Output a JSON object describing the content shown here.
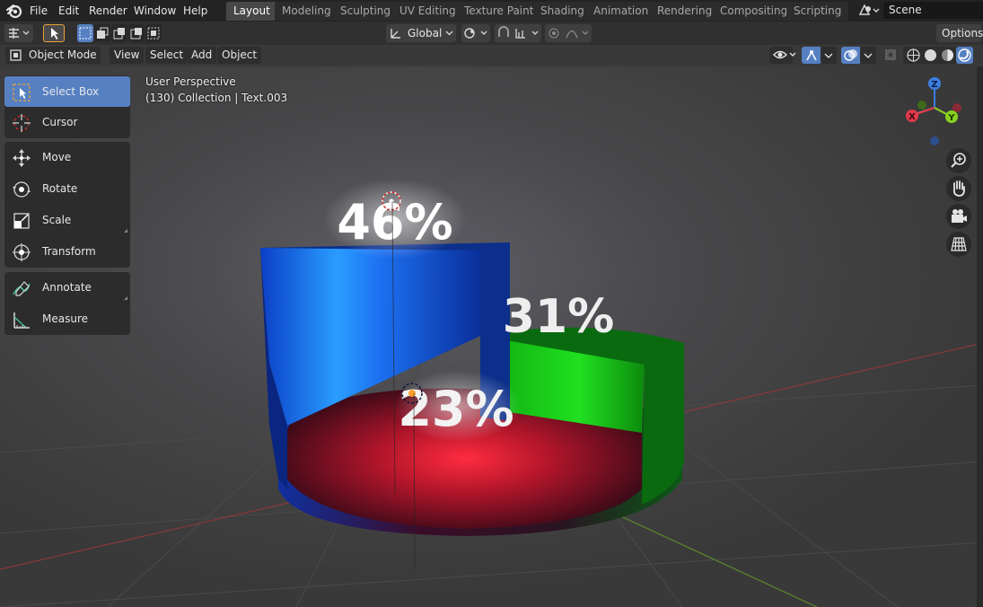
{
  "menu": {
    "file": "File",
    "edit": "Edit",
    "render": "Render",
    "window": "Window",
    "help": "Help"
  },
  "workspaces": [
    "Layout",
    "Modeling",
    "Sculpting",
    "UV Editing",
    "Texture Paint",
    "Shading",
    "Animation",
    "Rendering",
    "Compositing",
    "Scripting"
  ],
  "scene": {
    "name": "Scene"
  },
  "header": {
    "transform_orientation": "Global",
    "options": "Options"
  },
  "viewport_header": {
    "mode": "Object Mode",
    "view": "View",
    "select": "Select",
    "add": "Add",
    "object": "Object"
  },
  "tools": [
    {
      "label": "Select Box",
      "icon": "select-box-icon"
    },
    {
      "label": "Cursor",
      "icon": "cursor-icon"
    },
    {
      "label": "Move",
      "icon": "move-icon"
    },
    {
      "label": "Rotate",
      "icon": "rotate-icon"
    },
    {
      "label": "Scale",
      "icon": "scale-icon"
    },
    {
      "label": "Transform",
      "icon": "transform-icon"
    },
    {
      "label": "Annotate",
      "icon": "annotate-icon"
    },
    {
      "label": "Measure",
      "icon": "measure-icon"
    }
  ],
  "viewport": {
    "perspective": "User Perspective",
    "collection": "(130) Collection | Text.003"
  },
  "gizmo": {
    "x": "X",
    "y": "Y",
    "z": "Z"
  },
  "pie": [
    {
      "label": "46%",
      "color": "#1a6cff"
    },
    {
      "label": "31%",
      "color": "#18d418"
    },
    {
      "label": "23%",
      "color": "#ff1e32"
    }
  ],
  "colors": {
    "accent": "#5680c2",
    "topbar": "#232323",
    "header": "#303030"
  }
}
